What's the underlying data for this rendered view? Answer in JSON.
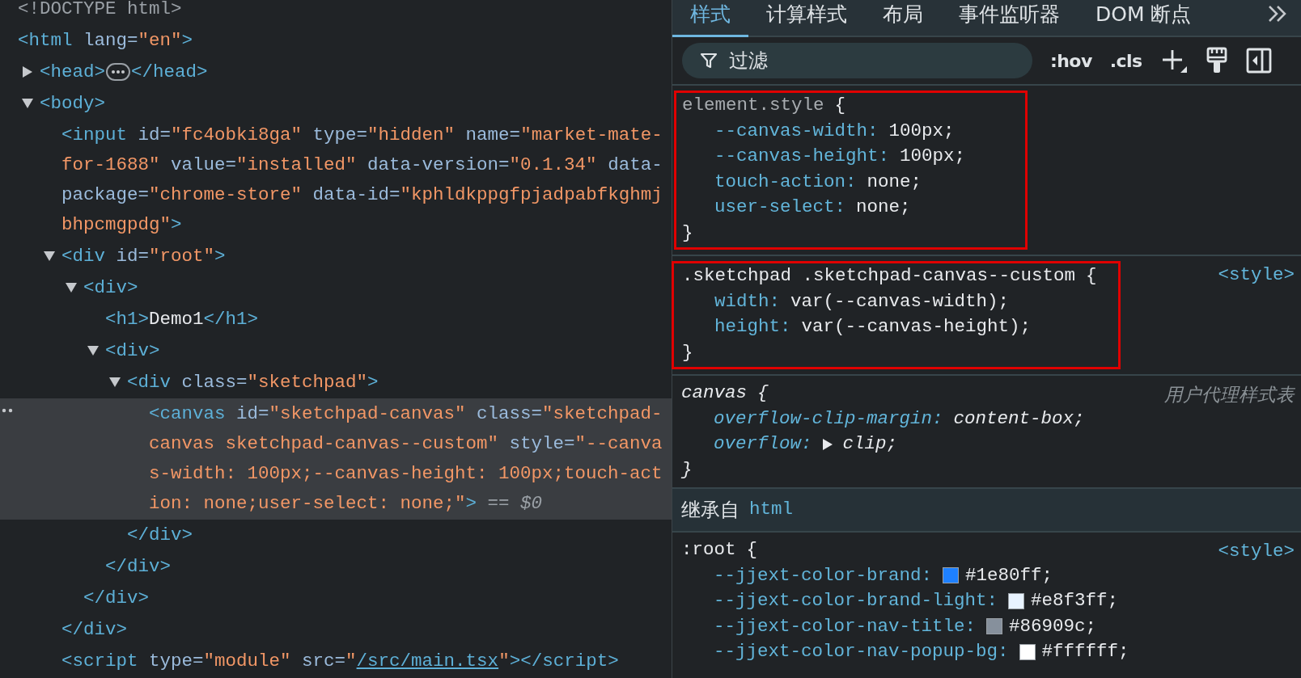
{
  "dom_tree": [
    {
      "selected": false,
      "parts": [
        {
          "kind": "doctype",
          "text": "<!DOCTYPE html>"
        }
      ]
    },
    {
      "selected": false,
      "parts": [
        {
          "kind": "tag",
          "text": "<html"
        },
        {
          "kind": "attr",
          "text": " lang="
        },
        {
          "kind": "value",
          "text": "\"en\""
        },
        {
          "kind": "tag",
          "text": ">"
        }
      ],
      "children": [
        {
          "expanded": false,
          "selected": false,
          "parts": [
            {
              "kind": "tag",
              "text": "<head>"
            },
            {
              "kind": "badge"
            },
            {
              "kind": "tag",
              "text": "</head>"
            }
          ]
        },
        {
          "expanded": true,
          "selected": false,
          "parts": [
            {
              "kind": "tag",
              "text": "<body>"
            }
          ],
          "children": [
            {
              "selected": false,
              "parts": [
                {
                  "kind": "tag",
                  "text": "<input"
                },
                {
                  "kind": "attr",
                  "text": " id="
                },
                {
                  "kind": "value",
                  "text": "\"fc4obki8ga\""
                },
                {
                  "kind": "attr",
                  "text": " type="
                },
                {
                  "kind": "value",
                  "text": "\"hidden\""
                },
                {
                  "kind": "attr",
                  "text": " name="
                },
                {
                  "kind": "value",
                  "text": "\"market-mate-for-1688\""
                },
                {
                  "kind": "attr",
                  "text": " value="
                },
                {
                  "kind": "value",
                  "text": "\"installed\""
                },
                {
                  "kind": "attr",
                  "text": " data-version="
                },
                {
                  "kind": "value",
                  "text": "\"0.1.34\""
                },
                {
                  "kind": "attr",
                  "text": " data-package="
                },
                {
                  "kind": "value",
                  "text": "\"chrome-store\""
                },
                {
                  "kind": "attr",
                  "text": " data-id="
                },
                {
                  "kind": "value",
                  "text": "\"kphldkppgfpjadpabfkghmjbhpcmgpdg\""
                },
                {
                  "kind": "tag",
                  "text": ">"
                }
              ]
            },
            {
              "expanded": true,
              "selected": false,
              "parts": [
                {
                  "kind": "tag",
                  "text": "<div"
                },
                {
                  "kind": "attr",
                  "text": " id="
                },
                {
                  "kind": "value",
                  "text": "\"root\""
                },
                {
                  "kind": "tag",
                  "text": ">"
                }
              ],
              "close": [
                {
                  "kind": "tag",
                  "text": "</div>"
                }
              ],
              "children": [
                {
                  "expanded": true,
                  "selected": false,
                  "parts": [
                    {
                      "kind": "tag",
                      "text": "<div>"
                    }
                  ],
                  "close": [
                    {
                      "kind": "tag",
                      "text": "</div>"
                    }
                  ],
                  "children": [
                    {
                      "selected": false,
                      "parts": [
                        {
                          "kind": "tag",
                          "text": "<h1>"
                        },
                        {
                          "kind": "text",
                          "text": "Demo1"
                        },
                        {
                          "kind": "tag",
                          "text": "</h1>"
                        }
                      ]
                    },
                    {
                      "expanded": true,
                      "selected": false,
                      "parts": [
                        {
                          "kind": "tag",
                          "text": "<div>"
                        }
                      ],
                      "close": [
                        {
                          "kind": "tag",
                          "text": "</div>"
                        }
                      ],
                      "children": [
                        {
                          "expanded": true,
                          "selected": false,
                          "parts": [
                            {
                              "kind": "tag",
                              "text": "<div"
                            },
                            {
                              "kind": "attr",
                              "text": " class="
                            },
                            {
                              "kind": "value",
                              "text": "\"sketchpad\""
                            },
                            {
                              "kind": "tag",
                              "text": ">"
                            }
                          ],
                          "close": [
                            {
                              "kind": "tag",
                              "text": "</div>"
                            }
                          ],
                          "children": [
                            {
                              "selected": true,
                              "parts": [
                                {
                                  "kind": "tag",
                                  "text": "<canvas"
                                },
                                {
                                  "kind": "attr",
                                  "text": " id="
                                },
                                {
                                  "kind": "value",
                                  "text": "\"sketchpad-canvas\""
                                },
                                {
                                  "kind": "attr",
                                  "text": " class="
                                },
                                {
                                  "kind": "value",
                                  "text": "\"sketchpad-canvas sketchpad-canvas--custom\""
                                },
                                {
                                  "kind": "attr",
                                  "text": " style="
                                },
                                {
                                  "kind": "value",
                                  "text": "\"--canvas-width: 100px;--canvas-height: 100px;touch-action: none;user-select: none;\""
                                },
                                {
                                  "kind": "tag",
                                  "text": ">"
                                },
                                {
                                  "kind": "ref",
                                  "text": " == $0"
                                }
                              ]
                            }
                          ]
                        }
                      ]
                    }
                  ]
                }
              ]
            },
            {
              "selected": false,
              "parts": [
                {
                  "kind": "tag",
                  "text": "<script"
                },
                {
                  "kind": "attr",
                  "text": " type="
                },
                {
                  "kind": "value",
                  "text": "\"module\""
                },
                {
                  "kind": "attr",
                  "text": " src="
                },
                {
                  "kind": "value",
                  "text": "\""
                },
                {
                  "kind": "link",
                  "text": "/src/main.tsx"
                },
                {
                  "kind": "value",
                  "text": "\""
                },
                {
                  "kind": "tag",
                  "text": "></script>"
                }
              ]
            }
          ]
        }
      ]
    }
  ],
  "tabs": [
    {
      "label": "样式",
      "selected": true
    },
    {
      "label": "计算样式",
      "selected": false
    },
    {
      "label": "布局",
      "selected": false
    },
    {
      "label": "事件监听器",
      "selected": false
    },
    {
      "label": "DOM 断点",
      "selected": false
    }
  ],
  "filter": {
    "placeholder": "过滤"
  },
  "toolbar": [
    ":hov",
    ".cls"
  ],
  "rules": [
    {
      "kind": "inline",
      "selector": "element.style",
      "brace": "{",
      "close": "}",
      "highlighted": true,
      "declarations": [
        {
          "kind": "plain",
          "property": "--canvas-width:",
          "value": "100px;"
        },
        {
          "kind": "plain",
          "property": "--canvas-height:",
          "value": "100px;"
        },
        {
          "kind": "plain",
          "property": "touch-action:",
          "value": "none;"
        },
        {
          "kind": "plain",
          "property": "user-select:",
          "value": "none;"
        }
      ]
    },
    {
      "kind": "author",
      "selector": ".sketchpad .sketchpad-canvas--custom",
      "brace": "{",
      "close": "}",
      "source": "<style>",
      "highlighted": true,
      "declarations": [
        {
          "kind": "plain",
          "property": "width:",
          "value": "var(--canvas-width);"
        },
        {
          "kind": "plain",
          "property": "height:",
          "value": "var(--canvas-height);"
        }
      ]
    },
    {
      "kind": "user-agent",
      "selector": "canvas",
      "brace": "{",
      "close": "}",
      "source": "用户代理样式表",
      "highlighted": false,
      "declarations": [
        {
          "kind": "plain",
          "property": "overflow-clip-margin:",
          "value": "content-box;"
        },
        {
          "kind": "toggle",
          "expanded": false,
          "property": "overflow:",
          "value": "clip;"
        }
      ]
    }
  ],
  "inherited": {
    "label": "继承自",
    "element": "html",
    "rules": [
      {
        "kind": "author",
        "selector": ":root",
        "brace": "{",
        "source": "<style>",
        "highlighted": false,
        "declarations": [
          {
            "kind": "color",
            "color": "#1e80ff",
            "property": "--jjext-color-brand:",
            "value": "#1e80ff;"
          },
          {
            "kind": "color",
            "color": "#e8f3ff",
            "property": "--jjext-color-brand-light:",
            "value": "#e8f3ff;"
          },
          {
            "kind": "color",
            "color": "#86909c",
            "property": "--jjext-color-nav-title:",
            "value": "#86909c;"
          },
          {
            "kind": "color",
            "color": "#ffffff",
            "property": "--jjext-color-nav-popup-bg:",
            "value": "#ffffff;"
          }
        ]
      }
    ]
  }
}
